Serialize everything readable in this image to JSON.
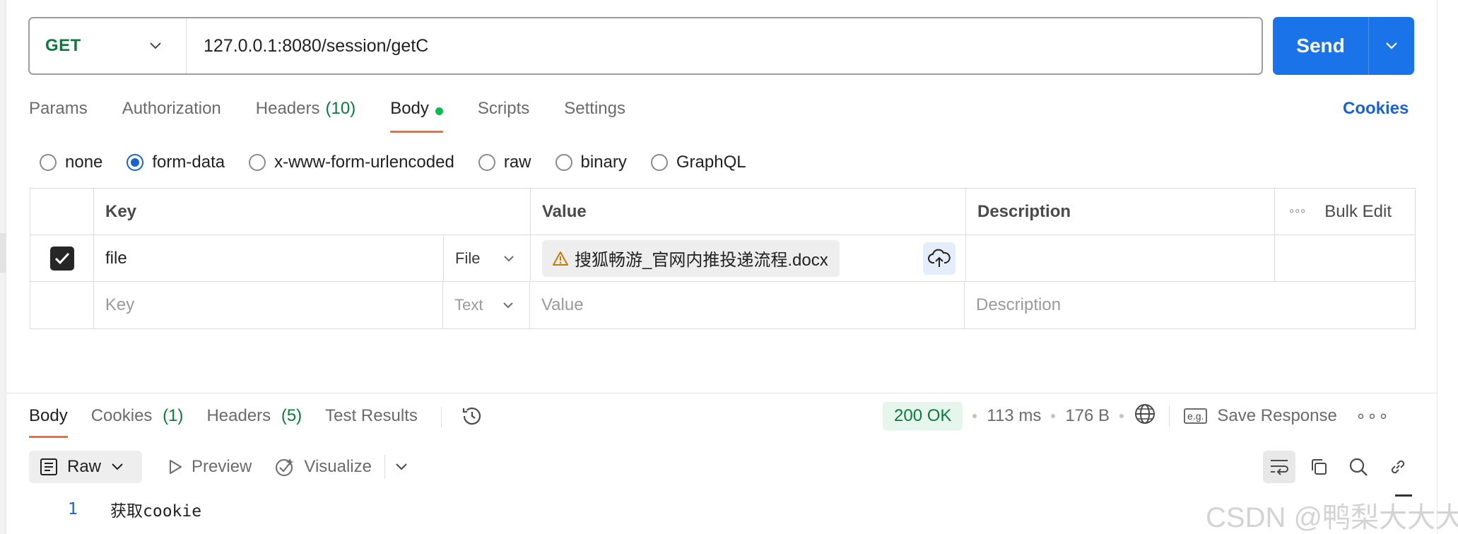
{
  "request": {
    "method": "GET",
    "url": "127.0.0.1:8080/session/getC",
    "send_label": "Send",
    "cookies_label": "Cookies"
  },
  "req_tabs": [
    {
      "label": "Params"
    },
    {
      "label": "Authorization"
    },
    {
      "label": "Headers",
      "count": "(10)"
    },
    {
      "label": "Body"
    },
    {
      "label": "Scripts"
    },
    {
      "label": "Settings"
    }
  ],
  "body_types": [
    "none",
    "form-data",
    "x-www-form-urlencoded",
    "raw",
    "binary",
    "GraphQL"
  ],
  "body_type_selected": "form-data",
  "table": {
    "headers": {
      "key": "Key",
      "value": "Value",
      "description": "Description",
      "bulk_edit": "Bulk Edit"
    },
    "rows": [
      {
        "key": "file",
        "type": "File",
        "value": "搜狐畅游_官网内推投递流程.docx",
        "description": ""
      }
    ],
    "placeholder": {
      "key": "Key",
      "type": "Text",
      "value": "Value",
      "description": "Description"
    }
  },
  "resp_tabs": [
    {
      "label": "Body"
    },
    {
      "label": "Cookies",
      "count": "(1)"
    },
    {
      "label": "Headers",
      "count": "(5)"
    },
    {
      "label": "Test Results"
    }
  ],
  "resp_meta": {
    "status": "200 OK",
    "time": "113 ms",
    "size": "176 B",
    "eg": "e.g.",
    "save_label": "Save Response"
  },
  "format_bar": {
    "raw_label": "Raw",
    "preview_label": "Preview",
    "visualize_label": "Visualize"
  },
  "response_body": [
    {
      "line": "1",
      "text": "获取cookie"
    }
  ],
  "watermark": "CSDN @鸭梨大大大",
  "colors": {
    "send": "#1a73e8",
    "method": "#0c7a3e",
    "active_tab": "#f26b3a",
    "link": "#1a62d4",
    "status_bg": "#e6f6ec"
  }
}
